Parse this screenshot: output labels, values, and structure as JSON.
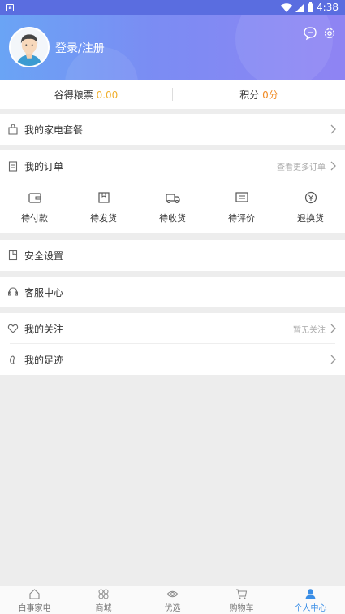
{
  "status_bar": {
    "time": "4:38",
    "app_badge": "a"
  },
  "header": {
    "login_label": "登录/注册"
  },
  "points": {
    "grain_label": "谷得粮票",
    "grain_value": "0.00",
    "score_label": "积分",
    "score_value": "0分"
  },
  "menu": {
    "package": "我的家电套餐",
    "orders": "我的订单",
    "orders_more": "查看更多订单",
    "security": "安全设置",
    "service": "客服中心",
    "follow": "我的关注",
    "follow_extra": "暂无关注",
    "footprint": "我的足迹"
  },
  "order_states": [
    {
      "label": "待付款",
      "icon": "wallet-icon"
    },
    {
      "label": "待发货",
      "icon": "box-icon"
    },
    {
      "label": "待收货",
      "icon": "truck-icon"
    },
    {
      "label": "待评价",
      "icon": "comment-icon"
    },
    {
      "label": "退换货",
      "icon": "refund-icon"
    }
  ],
  "tabs": [
    {
      "label": "白事家电",
      "icon": "home-icon",
      "active": false
    },
    {
      "label": "商城",
      "icon": "grid-icon",
      "active": false
    },
    {
      "label": "优选",
      "icon": "eye-icon",
      "active": false
    },
    {
      "label": "购物车",
      "icon": "cart-icon",
      "active": false
    },
    {
      "label": "个人中心",
      "icon": "person-icon",
      "active": true
    }
  ],
  "colors": {
    "accent": "#3a8ee6",
    "header_start": "#6aa4f5",
    "header_end": "#8f84f3",
    "points_yellow": "#f0b030",
    "points_orange": "#f08a24"
  }
}
